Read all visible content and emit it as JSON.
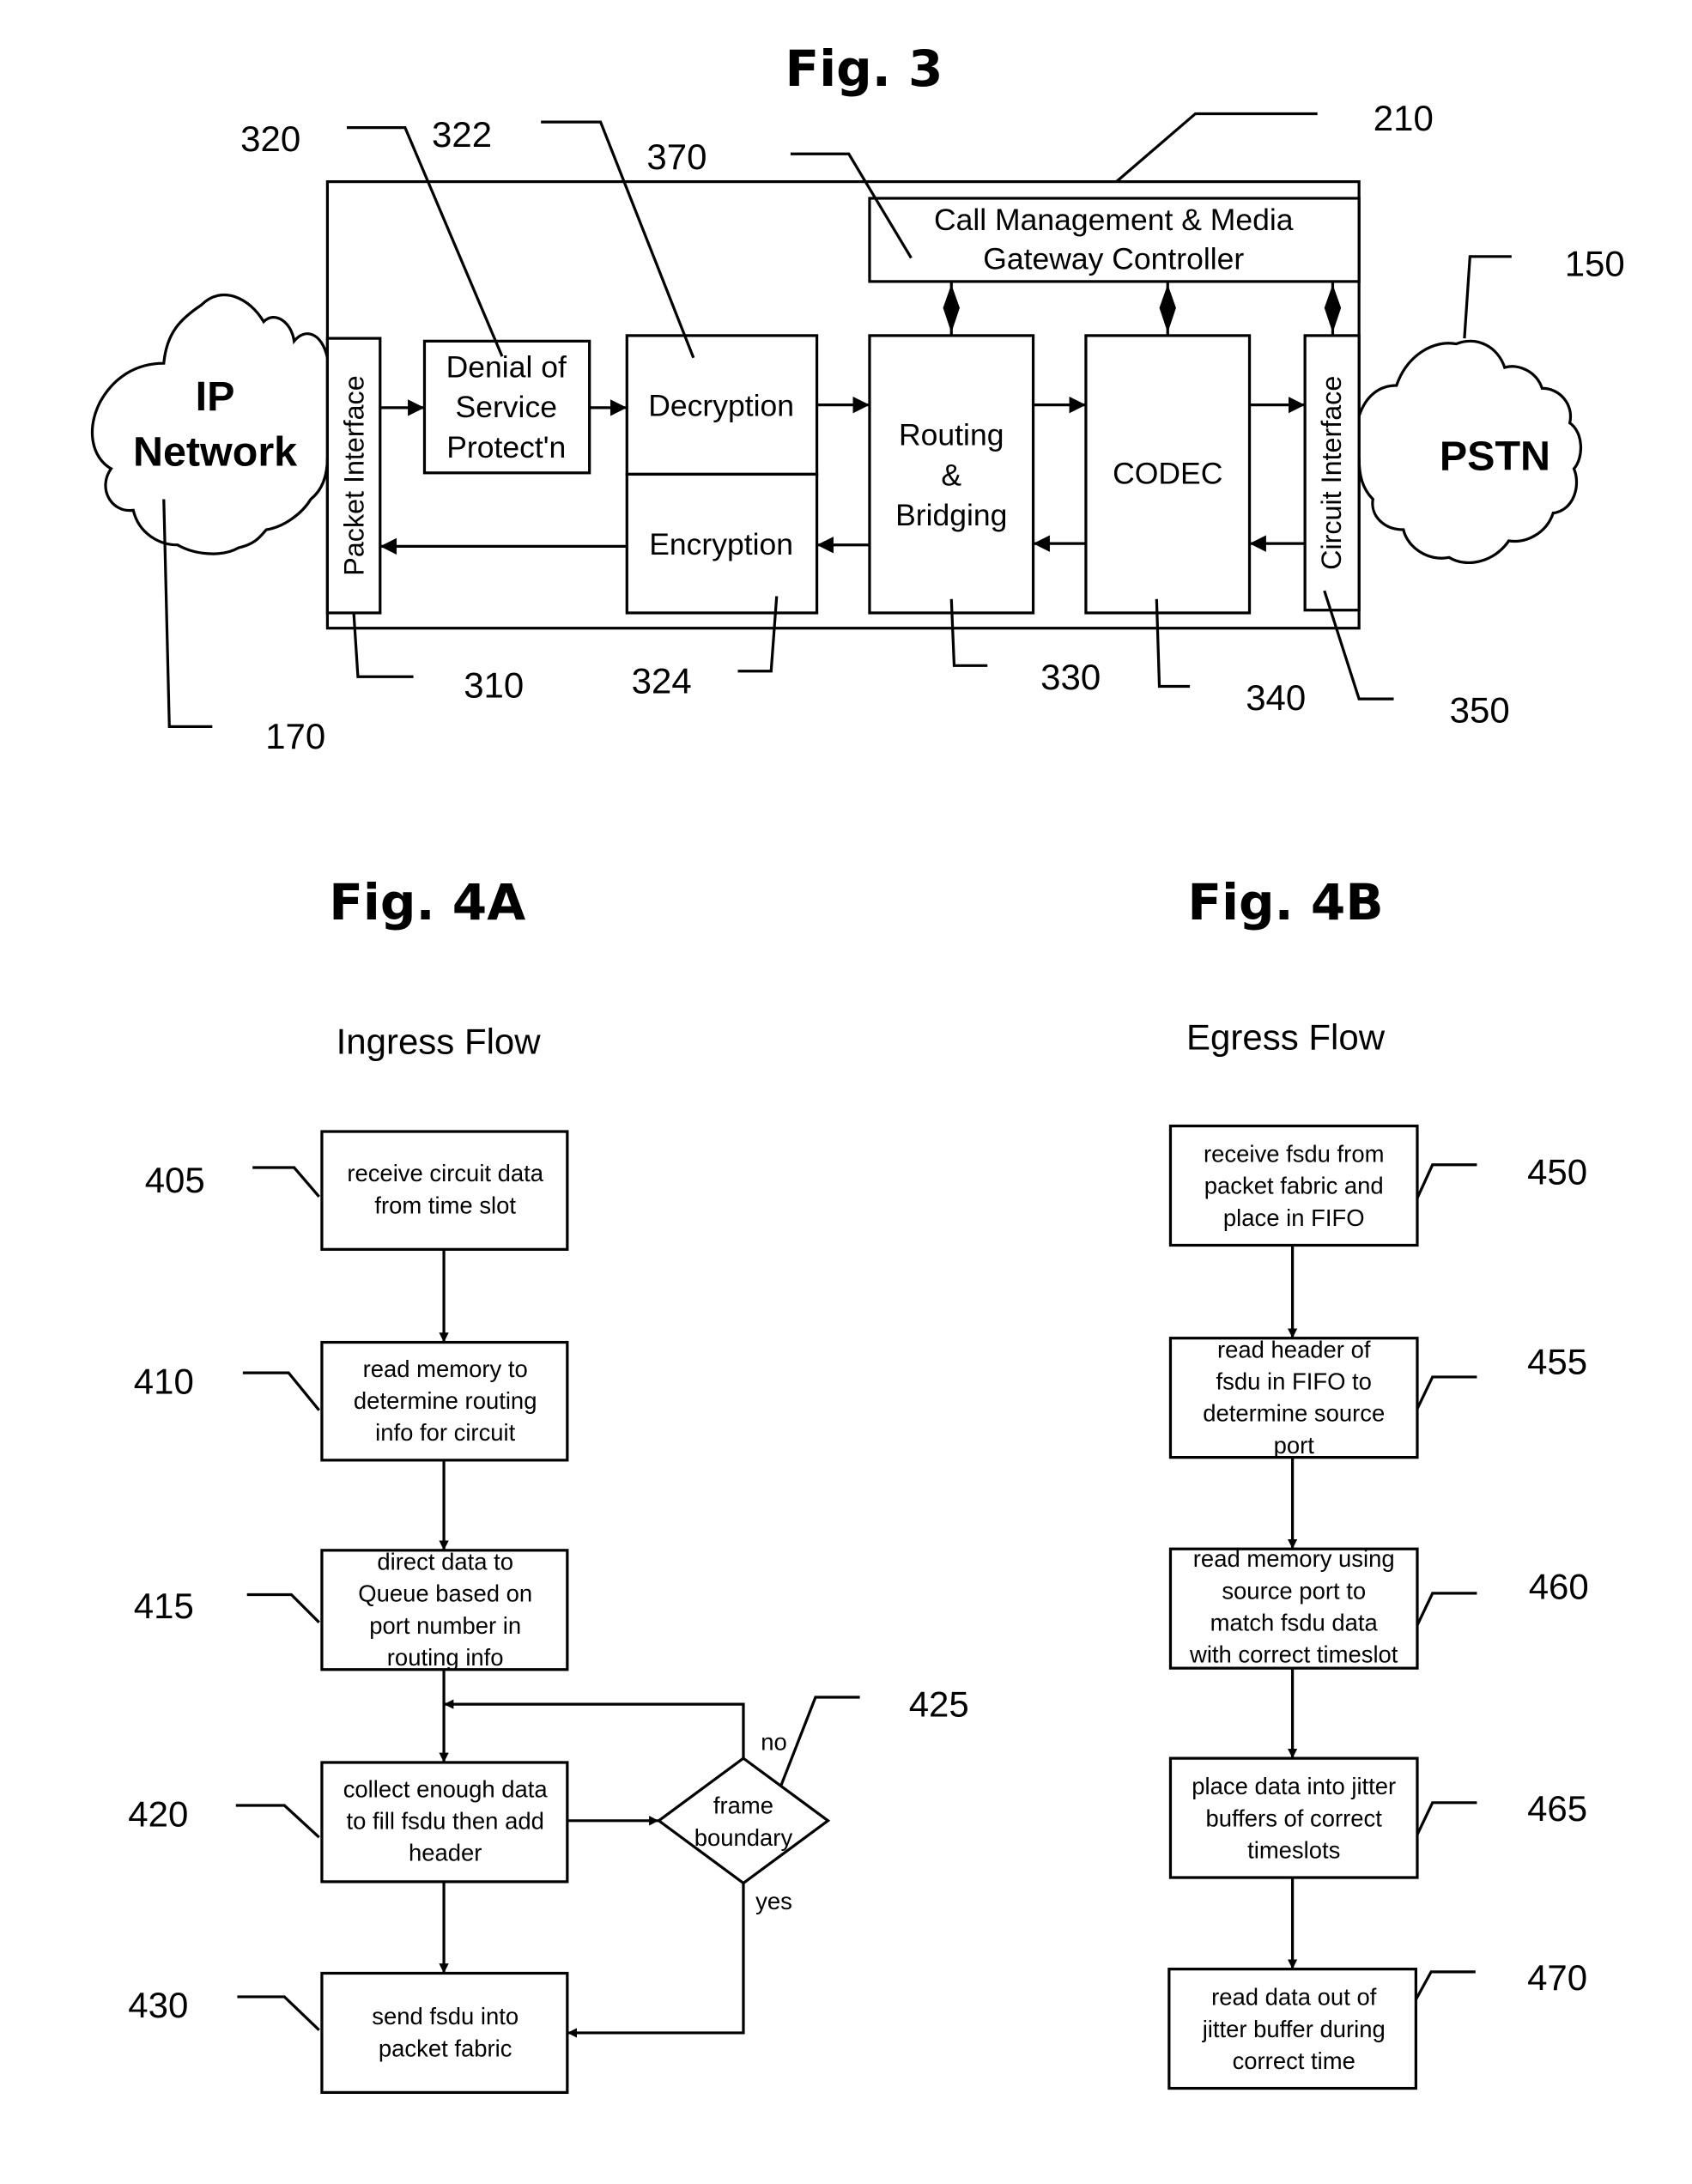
{
  "fig3": {
    "title": "Fig. 3",
    "ip_network": [
      "IP",
      "Network"
    ],
    "pstn": "PSTN",
    "packet_interface": "Packet Interface",
    "circuit_interface": "Circuit Interface",
    "dos": [
      "Denial of",
      "Service",
      "Protect'n"
    ],
    "decryption": "Decryption",
    "encryption": "Encryption",
    "routing": [
      "Routing",
      "&",
      "Bridging"
    ],
    "codec": "CODEC",
    "call_mgmt": [
      "Call Management & Media",
      "Gateway Controller"
    ],
    "refs": {
      "r320": "320",
      "r322": "322",
      "r370": "370",
      "r210": "210",
      "r150": "150",
      "r170": "170",
      "r310": "310",
      "r324": "324",
      "r330": "330",
      "r340": "340",
      "r350": "350"
    }
  },
  "fig4a": {
    "title": "Fig. 4A",
    "subtitle": "Ingress Flow",
    "steps": [
      {
        "ref": "405",
        "lines": [
          "receive circuit data",
          "from time slot"
        ]
      },
      {
        "ref": "410",
        "lines": [
          "read memory to",
          "determine routing",
          "info for circuit"
        ]
      },
      {
        "ref": "415",
        "lines": [
          "direct data to",
          "Queue based on",
          "port number in",
          "routing  info"
        ]
      },
      {
        "ref": "420",
        "lines": [
          "collect enough data",
          "to fill fsdu then add",
          "header"
        ]
      },
      {
        "ref": "430",
        "lines": [
          "send fsdu into",
          "packet fabric"
        ]
      }
    ],
    "decision": {
      "ref": "425",
      "lines": [
        "frame",
        "boundary"
      ],
      "no": "no",
      "yes": "yes"
    }
  },
  "fig4b": {
    "title": "Fig. 4B",
    "subtitle": "Egress Flow",
    "steps": [
      {
        "ref": "450",
        "lines": [
          "receive fsdu from",
          "packet fabric and",
          "place in FIFO"
        ]
      },
      {
        "ref": "455",
        "lines": [
          "read header  of",
          "fsdu in FIFO to",
          "determine source",
          "port"
        ]
      },
      {
        "ref": "460",
        "lines": [
          "read memory using",
          "source port to",
          "match fsdu data",
          "with correct timeslot"
        ]
      },
      {
        "ref": "465",
        "lines": [
          "place data into jitter",
          "buffers of correct",
          "timeslots"
        ]
      },
      {
        "ref": "470",
        "lines": [
          "read data out of",
          "jitter buffer during",
          "correct time"
        ]
      }
    ]
  }
}
